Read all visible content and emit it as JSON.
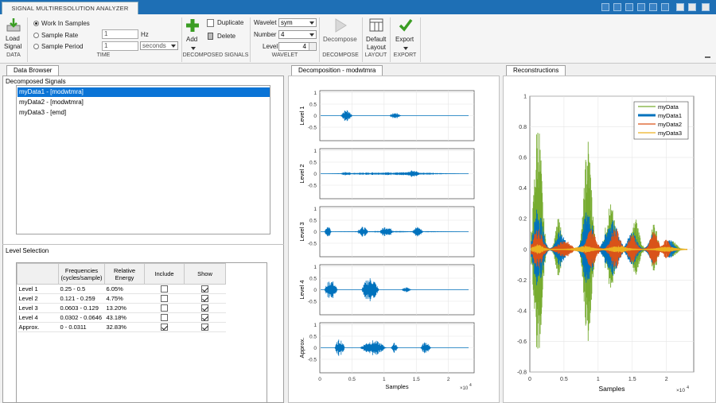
{
  "app": {
    "tab": "SIGNAL MULTIRESOLUTION ANALYZER"
  },
  "ribbon": {
    "load": {
      "line1": "Load",
      "line2": "Signal"
    },
    "time": {
      "work_in_samples": "Work In Samples",
      "sample_rate": "Sample Rate",
      "sample_period": "Sample Period",
      "rate_value": "1",
      "rate_unit": "Hz",
      "period_value": "1",
      "period_unit": "seconds",
      "selected": "Work In Samples"
    },
    "add": "Add",
    "duplicate": "Duplicate",
    "delete": "Delete",
    "wavelet": {
      "wavelet_label": "Wavelet",
      "wavelet_value": "sym",
      "number_label": "Number",
      "number_value": "4",
      "level_label": "Level",
      "level_value": "4"
    },
    "decompose": "Decompose",
    "layout": {
      "line1": "Default",
      "line2": "Layout"
    },
    "export": "Export",
    "sections": {
      "data": "DATA",
      "time": "TIME",
      "decomposed": "DECOMPOSED SIGNALS",
      "wavelet": "WAVELET",
      "decompose": "DECOMPOSE",
      "layout": "LAYOUT",
      "export": "EXPORT"
    }
  },
  "browser": {
    "tab": "Data Browser",
    "decomposed_label": "Decomposed  Signals",
    "signals": [
      "myData1 - [modwtmra]",
      "myData2 - [modwtmra]",
      "myData3 - [emd]"
    ],
    "selected_index": 0,
    "level_selection_label": "Level Selection",
    "columns": [
      "",
      "Frequencies (cycles/sample)",
      "Relative Energy",
      "Include",
      "Show"
    ],
    "rows": [
      {
        "level": "Level 1",
        "freq": "0.25 - 0.5",
        "energy": "6.05%",
        "include": false,
        "show": true
      },
      {
        "level": "Level 2",
        "freq": "0.121 - 0.259",
        "energy": "4.75%",
        "include": false,
        "show": true
      },
      {
        "level": "Level 3",
        "freq": "0.0603 - 0.129",
        "energy": "13.20%",
        "include": false,
        "show": true
      },
      {
        "level": "Level 4",
        "freq": "0.0302 - 0.0646",
        "energy": "43.18%",
        "include": false,
        "show": true
      },
      {
        "level": "Approx.",
        "freq": "0 - 0.0311",
        "energy": "32.83%",
        "include": true,
        "show": true
      }
    ]
  },
  "decomposition": {
    "tab": "Decomposition - modwtmra",
    "levels": [
      "Level 1",
      "Level 2",
      "Level 3",
      "Level 4",
      "Approx."
    ],
    "yticks": [
      "1",
      "0.5",
      "0",
      "-0.5"
    ],
    "xticks": [
      "0",
      "0.5",
      "1",
      "1.5",
      "2"
    ],
    "xlabel": "Samples",
    "exponent": "×10",
    "exponent_power": "4",
    "color": "#0072bd"
  },
  "reconstructions": {
    "tab": "Reconstructions",
    "yticks": [
      "1",
      "0.8",
      "0.6",
      "0.4",
      "0.2",
      "0",
      "-0.2",
      "-0.4",
      "-0.6",
      "-0.8"
    ],
    "xticks": [
      "0",
      "0.5",
      "1",
      "1.5",
      "2"
    ],
    "xlabel": "Samples",
    "exponent": "×10",
    "exponent_power": "4",
    "legend": [
      {
        "name": "myData",
        "color": "#77ac30"
      },
      {
        "name": "myData1",
        "color": "#0072bd"
      },
      {
        "name": "myData2",
        "color": "#d95319"
      },
      {
        "name": "myData3",
        "color": "#edb120"
      }
    ]
  }
}
